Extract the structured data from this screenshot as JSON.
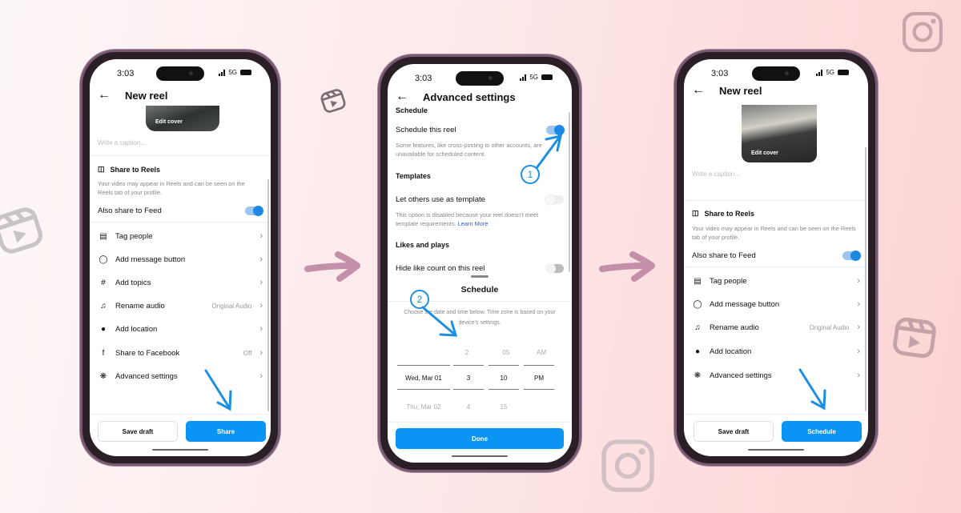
{
  "status": {
    "time": "3:03",
    "network": "5G"
  },
  "phone1": {
    "title": "New reel",
    "cover_label": "Edit cover",
    "caption_placeholder": "Write a caption...",
    "share_reels_title": "Share to Reels",
    "share_reels_help": "Your video may appear in Reels and can be seen on the Reels tab of your profile.",
    "also_feed_label": "Also share to Feed",
    "also_feed_on": true,
    "rows": [
      {
        "label": "Tag people",
        "icon": "tag-people-icon",
        "value": ""
      },
      {
        "label": "Add message button",
        "icon": "message-icon",
        "value": ""
      },
      {
        "label": "Add topics",
        "icon": "hashtag-icon",
        "value": ""
      },
      {
        "label": "Rename audio",
        "icon": "audio-icon",
        "value": "Original Audio"
      },
      {
        "label": "Add location",
        "icon": "location-icon",
        "value": ""
      },
      {
        "label": "Share to Facebook",
        "icon": "facebook-icon",
        "value": "Off"
      },
      {
        "label": "Advanced settings",
        "icon": "settings-icon",
        "value": ""
      }
    ],
    "save_draft": "Save draft",
    "primary": "Share"
  },
  "phone2": {
    "title": "Advanced settings",
    "schedule_heading": "Schedule",
    "schedule_label": "Schedule this reel",
    "schedule_on": true,
    "schedule_help": "Some features, like cross-posting to other accounts, are unavailable for scheduled content.",
    "templates_heading": "Templates",
    "template_label": "Let others use as template",
    "template_help": "This option is disabled because your reel doesn't meet template requirements.",
    "learn_more": "Learn More",
    "likes_heading": "Likes and plays",
    "hide_likes_label": "Hide like count on this reel",
    "sheet_title": "Schedule",
    "sheet_help": "Choose the date and time below. Time zone is based on your device's settings.",
    "picker": {
      "prev": [
        "",
        "2",
        "05",
        "AM"
      ],
      "selected": [
        "Wed, Mar 01",
        "3",
        "10",
        "PM"
      ],
      "next": [
        "Thu, Mar 02",
        "4",
        "15",
        ""
      ]
    },
    "done": "Done",
    "step1": "1",
    "step2": "2"
  },
  "phone3": {
    "title": "New reel",
    "cover_label": "Edit cover",
    "caption_placeholder": "Write a caption...",
    "share_reels_title": "Share to Reels",
    "share_reels_help": "Your video may appear in Reels and can be seen on the Reels tab of your profile.",
    "also_feed_label": "Also share to Feed",
    "rows": [
      {
        "label": "Tag people",
        "icon": "tag-people-icon",
        "value": ""
      },
      {
        "label": "Add message button",
        "icon": "message-icon",
        "value": ""
      },
      {
        "label": "Rename audio",
        "icon": "audio-icon",
        "value": "Original Audio"
      },
      {
        "label": "Add location",
        "icon": "location-icon",
        "value": ""
      },
      {
        "label": "Advanced settings",
        "icon": "settings-icon",
        "value": ""
      }
    ],
    "save_draft": "Save draft",
    "primary": "Schedule"
  },
  "colors": {
    "accent": "#0a95f5",
    "annotation": "#1d8fe0",
    "flow_arrow": "#c48fa8"
  }
}
